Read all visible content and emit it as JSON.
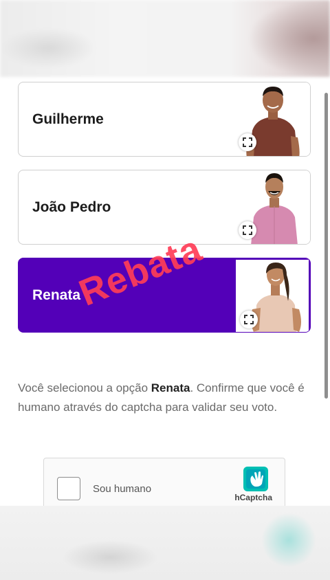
{
  "candidates": [
    {
      "name": "Guilherme",
      "selected": false,
      "photo_colors": {
        "shirt": "#7a3b2e",
        "skin": "#a46a4a",
        "hair": "#1e1410"
      }
    },
    {
      "name": "João Pedro",
      "selected": false,
      "photo_colors": {
        "shirt": "#d68ab0",
        "skin": "#b5805c",
        "hair": "#1a120c"
      }
    },
    {
      "name": "Renata",
      "selected": true,
      "photo_colors": {
        "shirt": "#e8c8b4",
        "skin": "#c28a63",
        "hair": "#3a2618"
      }
    }
  ],
  "watermark": "Rebata",
  "info": {
    "prefix": "Você selecionou a opção ",
    "selected_name": "Renata",
    "suffix": ". Confirme que você é humano através do captcha para validar seu voto."
  },
  "captcha": {
    "label": "Sou humano",
    "brand": "hCaptcha"
  },
  "icons": {
    "expand": "expand-icon",
    "captcha_logo": "hcaptcha-logo-icon"
  },
  "colors": {
    "selected_card": "#5300b8",
    "watermark": "#ff3d57",
    "hcaptcha_teal": "#00bfb3"
  }
}
